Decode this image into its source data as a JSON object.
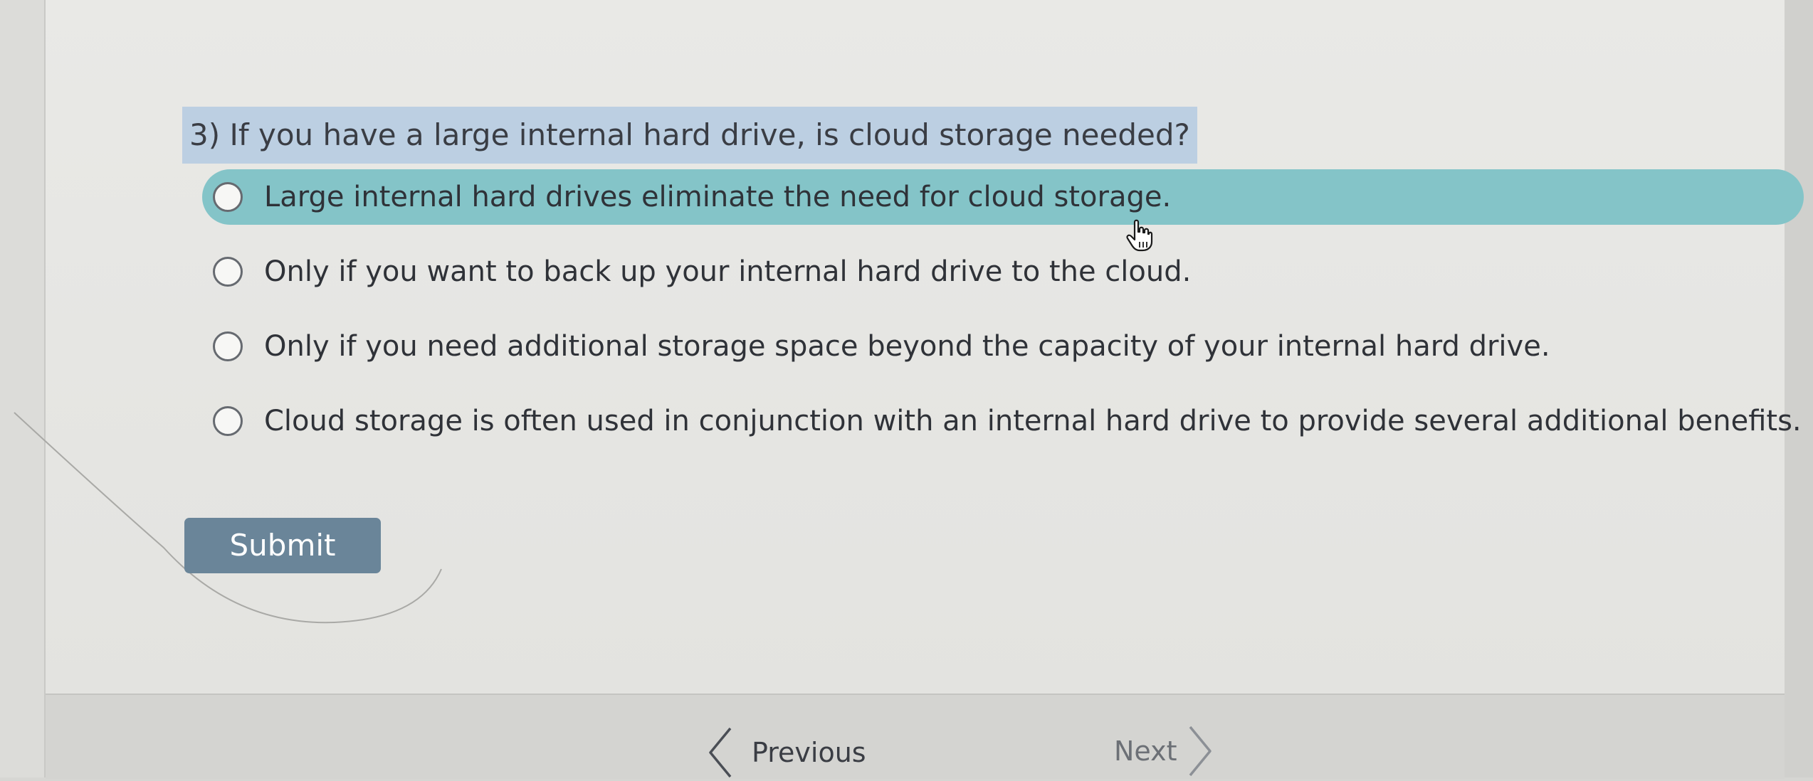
{
  "question": {
    "text": "3) If you have a large internal hard drive, is cloud storage needed?"
  },
  "options": [
    {
      "label": "Large internal hard drives eliminate the need for cloud storage.",
      "selected": true
    },
    {
      "label": "Only if you want to back up your internal hard drive to the cloud.",
      "selected": false
    },
    {
      "label": "Only if you need additional storage space beyond the capacity of your internal hard drive.",
      "selected": false
    },
    {
      "label": "Cloud storage is often used in conjunction with an internal hard drive to provide several additional benefits.",
      "selected": false
    }
  ],
  "submit_label": "Submit",
  "navigation": {
    "previous_label": "Previous",
    "next_label": "Next"
  },
  "colors": {
    "highlight_option": "#84c4c8",
    "question_highlight": "#bccfe2",
    "submit_button": "#6a8599"
  },
  "icons": {
    "cursor": "hand-pointer-icon",
    "previous": "chevron-left-icon",
    "next": "chevron-right-icon"
  }
}
